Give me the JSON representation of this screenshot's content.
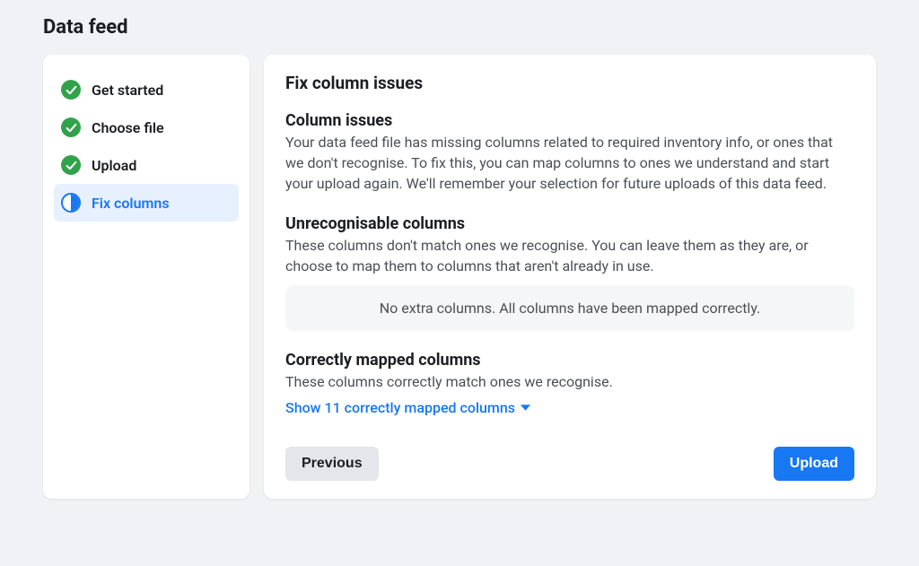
{
  "page": {
    "title": "Data feed"
  },
  "sidebar": {
    "steps": [
      {
        "label": "Get started",
        "state": "done"
      },
      {
        "label": "Choose file",
        "state": "done"
      },
      {
        "label": "Upload",
        "state": "done"
      },
      {
        "label": "Fix columns",
        "state": "current"
      }
    ]
  },
  "main": {
    "title": "Fix column issues",
    "sections": {
      "column_issues": {
        "heading": "Column issues",
        "description": "Your data feed file has missing columns related to required inventory info, or ones that we don't recognise. To fix this, you can map columns to ones we understand and start your upload again. We'll remember your selection for future uploads of this data feed."
      },
      "unrecognisable": {
        "heading": "Unrecognisable columns",
        "description": "These columns don't match ones we recognise. You can leave them as they are, or choose to map them to columns that aren't already in use.",
        "info_box": "No extra columns. All columns have been mapped correctly."
      },
      "correctly_mapped": {
        "heading": "Correctly mapped columns",
        "description": "These columns correctly match ones we recognise.",
        "show_link": "Show 11 correctly mapped columns",
        "mapped_count": 11
      }
    },
    "footer": {
      "previous": "Previous",
      "upload": "Upload"
    }
  }
}
